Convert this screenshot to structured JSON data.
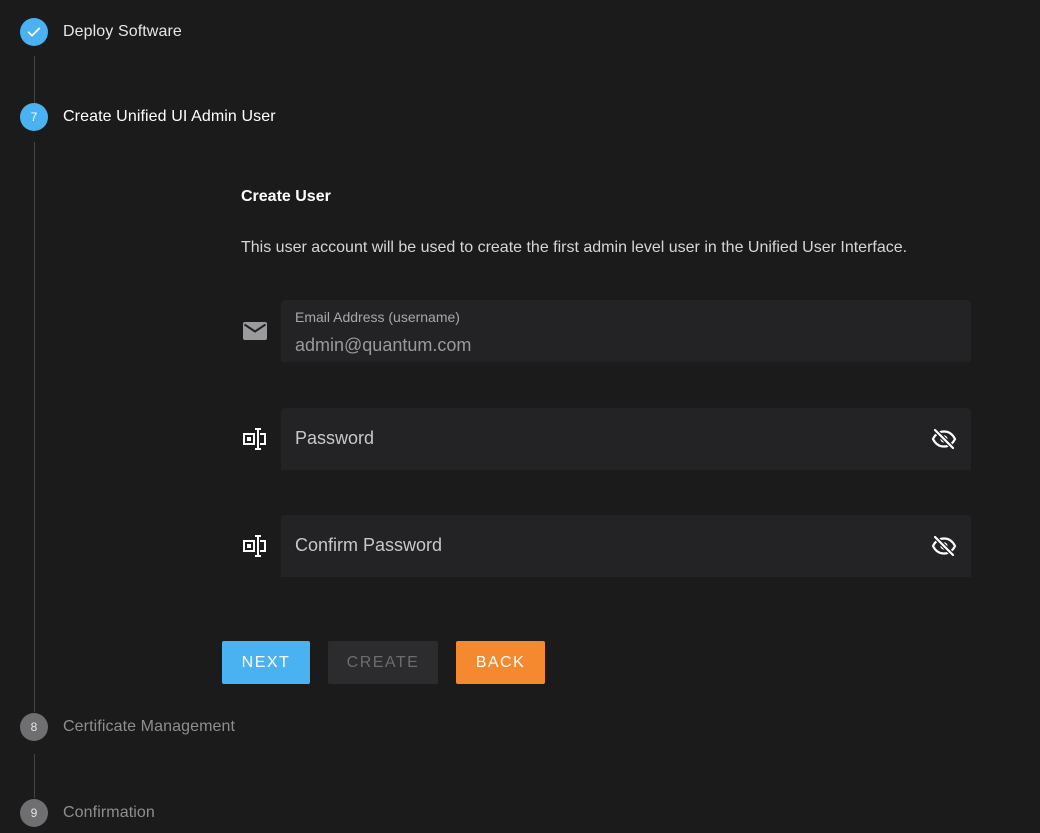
{
  "steps": [
    {
      "number": "",
      "label": "Deploy Software",
      "state": "done"
    },
    {
      "number": "7",
      "label": "Create Unified UI Admin User",
      "state": "active"
    },
    {
      "number": "8",
      "label": "Certificate Management",
      "state": "pending"
    },
    {
      "number": "9",
      "label": "Confirmation",
      "state": "pending"
    }
  ],
  "form": {
    "title": "Create User",
    "description": "This user account will be used to create the first admin level user in the Unified User Interface.",
    "email": {
      "label": "Email Address (username)",
      "value": "admin@quantum.com",
      "icon": "email-icon"
    },
    "password": {
      "placeholder": "Password",
      "icon": "password-icon",
      "toggle_icon": "eye-off-icon"
    },
    "confirm_password": {
      "placeholder": "Confirm Password",
      "icon": "password-icon",
      "toggle_icon": "eye-off-icon"
    }
  },
  "buttons": {
    "next": "NEXT",
    "create": "CREATE",
    "back": "BACK"
  },
  "colors": {
    "accent": "#4ab2f0",
    "back_button": "#f5892f",
    "background": "#1b1b1c"
  }
}
